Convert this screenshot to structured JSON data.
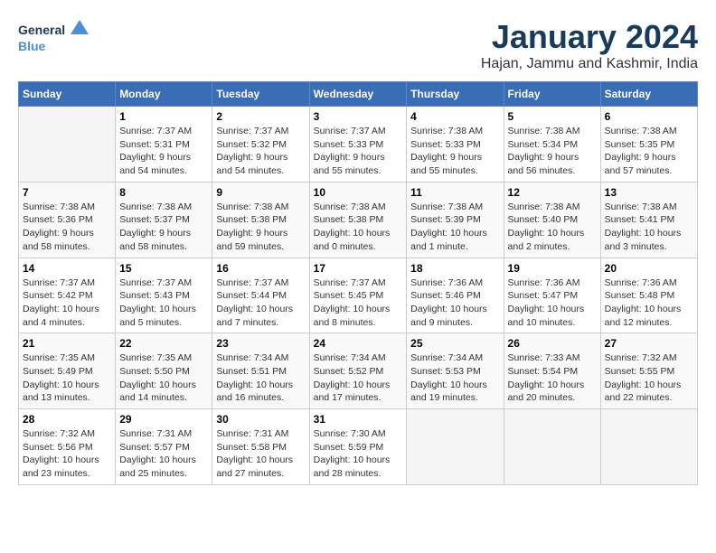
{
  "logo": {
    "text_general": "General",
    "text_blue": "Blue"
  },
  "title": "January 2024",
  "location": "Hajan, Jammu and Kashmir, India",
  "days_of_week": [
    "Sunday",
    "Monday",
    "Tuesday",
    "Wednesday",
    "Thursday",
    "Friday",
    "Saturday"
  ],
  "weeks": [
    [
      {
        "day": "",
        "sunrise": "",
        "sunset": "",
        "daylight": ""
      },
      {
        "day": "1",
        "sunrise": "Sunrise: 7:37 AM",
        "sunset": "Sunset: 5:31 PM",
        "daylight": "Daylight: 9 hours and 54 minutes."
      },
      {
        "day": "2",
        "sunrise": "Sunrise: 7:37 AM",
        "sunset": "Sunset: 5:32 PM",
        "daylight": "Daylight: 9 hours and 54 minutes."
      },
      {
        "day": "3",
        "sunrise": "Sunrise: 7:37 AM",
        "sunset": "Sunset: 5:33 PM",
        "daylight": "Daylight: 9 hours and 55 minutes."
      },
      {
        "day": "4",
        "sunrise": "Sunrise: 7:38 AM",
        "sunset": "Sunset: 5:33 PM",
        "daylight": "Daylight: 9 hours and 55 minutes."
      },
      {
        "day": "5",
        "sunrise": "Sunrise: 7:38 AM",
        "sunset": "Sunset: 5:34 PM",
        "daylight": "Daylight: 9 hours and 56 minutes."
      },
      {
        "day": "6",
        "sunrise": "Sunrise: 7:38 AM",
        "sunset": "Sunset: 5:35 PM",
        "daylight": "Daylight: 9 hours and 57 minutes."
      }
    ],
    [
      {
        "day": "7",
        "sunrise": "Sunrise: 7:38 AM",
        "sunset": "Sunset: 5:36 PM",
        "daylight": "Daylight: 9 hours and 58 minutes."
      },
      {
        "day": "8",
        "sunrise": "Sunrise: 7:38 AM",
        "sunset": "Sunset: 5:37 PM",
        "daylight": "Daylight: 9 hours and 58 minutes."
      },
      {
        "day": "9",
        "sunrise": "Sunrise: 7:38 AM",
        "sunset": "Sunset: 5:38 PM",
        "daylight": "Daylight: 9 hours and 59 minutes."
      },
      {
        "day": "10",
        "sunrise": "Sunrise: 7:38 AM",
        "sunset": "Sunset: 5:38 PM",
        "daylight": "Daylight: 10 hours and 0 minutes."
      },
      {
        "day": "11",
        "sunrise": "Sunrise: 7:38 AM",
        "sunset": "Sunset: 5:39 PM",
        "daylight": "Daylight: 10 hours and 1 minute."
      },
      {
        "day": "12",
        "sunrise": "Sunrise: 7:38 AM",
        "sunset": "Sunset: 5:40 PM",
        "daylight": "Daylight: 10 hours and 2 minutes."
      },
      {
        "day": "13",
        "sunrise": "Sunrise: 7:38 AM",
        "sunset": "Sunset: 5:41 PM",
        "daylight": "Daylight: 10 hours and 3 minutes."
      }
    ],
    [
      {
        "day": "14",
        "sunrise": "Sunrise: 7:37 AM",
        "sunset": "Sunset: 5:42 PM",
        "daylight": "Daylight: 10 hours and 4 minutes."
      },
      {
        "day": "15",
        "sunrise": "Sunrise: 7:37 AM",
        "sunset": "Sunset: 5:43 PM",
        "daylight": "Daylight: 10 hours and 5 minutes."
      },
      {
        "day": "16",
        "sunrise": "Sunrise: 7:37 AM",
        "sunset": "Sunset: 5:44 PM",
        "daylight": "Daylight: 10 hours and 7 minutes."
      },
      {
        "day": "17",
        "sunrise": "Sunrise: 7:37 AM",
        "sunset": "Sunset: 5:45 PM",
        "daylight": "Daylight: 10 hours and 8 minutes."
      },
      {
        "day": "18",
        "sunrise": "Sunrise: 7:36 AM",
        "sunset": "Sunset: 5:46 PM",
        "daylight": "Daylight: 10 hours and 9 minutes."
      },
      {
        "day": "19",
        "sunrise": "Sunrise: 7:36 AM",
        "sunset": "Sunset: 5:47 PM",
        "daylight": "Daylight: 10 hours and 10 minutes."
      },
      {
        "day": "20",
        "sunrise": "Sunrise: 7:36 AM",
        "sunset": "Sunset: 5:48 PM",
        "daylight": "Daylight: 10 hours and 12 minutes."
      }
    ],
    [
      {
        "day": "21",
        "sunrise": "Sunrise: 7:35 AM",
        "sunset": "Sunset: 5:49 PM",
        "daylight": "Daylight: 10 hours and 13 minutes."
      },
      {
        "day": "22",
        "sunrise": "Sunrise: 7:35 AM",
        "sunset": "Sunset: 5:50 PM",
        "daylight": "Daylight: 10 hours and 14 minutes."
      },
      {
        "day": "23",
        "sunrise": "Sunrise: 7:34 AM",
        "sunset": "Sunset: 5:51 PM",
        "daylight": "Daylight: 10 hours and 16 minutes."
      },
      {
        "day": "24",
        "sunrise": "Sunrise: 7:34 AM",
        "sunset": "Sunset: 5:52 PM",
        "daylight": "Daylight: 10 hours and 17 minutes."
      },
      {
        "day": "25",
        "sunrise": "Sunrise: 7:34 AM",
        "sunset": "Sunset: 5:53 PM",
        "daylight": "Daylight: 10 hours and 19 minutes."
      },
      {
        "day": "26",
        "sunrise": "Sunrise: 7:33 AM",
        "sunset": "Sunset: 5:54 PM",
        "daylight": "Daylight: 10 hours and 20 minutes."
      },
      {
        "day": "27",
        "sunrise": "Sunrise: 7:32 AM",
        "sunset": "Sunset: 5:55 PM",
        "daylight": "Daylight: 10 hours and 22 minutes."
      }
    ],
    [
      {
        "day": "28",
        "sunrise": "Sunrise: 7:32 AM",
        "sunset": "Sunset: 5:56 PM",
        "daylight": "Daylight: 10 hours and 23 minutes."
      },
      {
        "day": "29",
        "sunrise": "Sunrise: 7:31 AM",
        "sunset": "Sunset: 5:57 PM",
        "daylight": "Daylight: 10 hours and 25 minutes."
      },
      {
        "day": "30",
        "sunrise": "Sunrise: 7:31 AM",
        "sunset": "Sunset: 5:58 PM",
        "daylight": "Daylight: 10 hours and 27 minutes."
      },
      {
        "day": "31",
        "sunrise": "Sunrise: 7:30 AM",
        "sunset": "Sunset: 5:59 PM",
        "daylight": "Daylight: 10 hours and 28 minutes."
      },
      {
        "day": "",
        "sunrise": "",
        "sunset": "",
        "daylight": ""
      },
      {
        "day": "",
        "sunrise": "",
        "sunset": "",
        "daylight": ""
      },
      {
        "day": "",
        "sunrise": "",
        "sunset": "",
        "daylight": ""
      }
    ]
  ]
}
